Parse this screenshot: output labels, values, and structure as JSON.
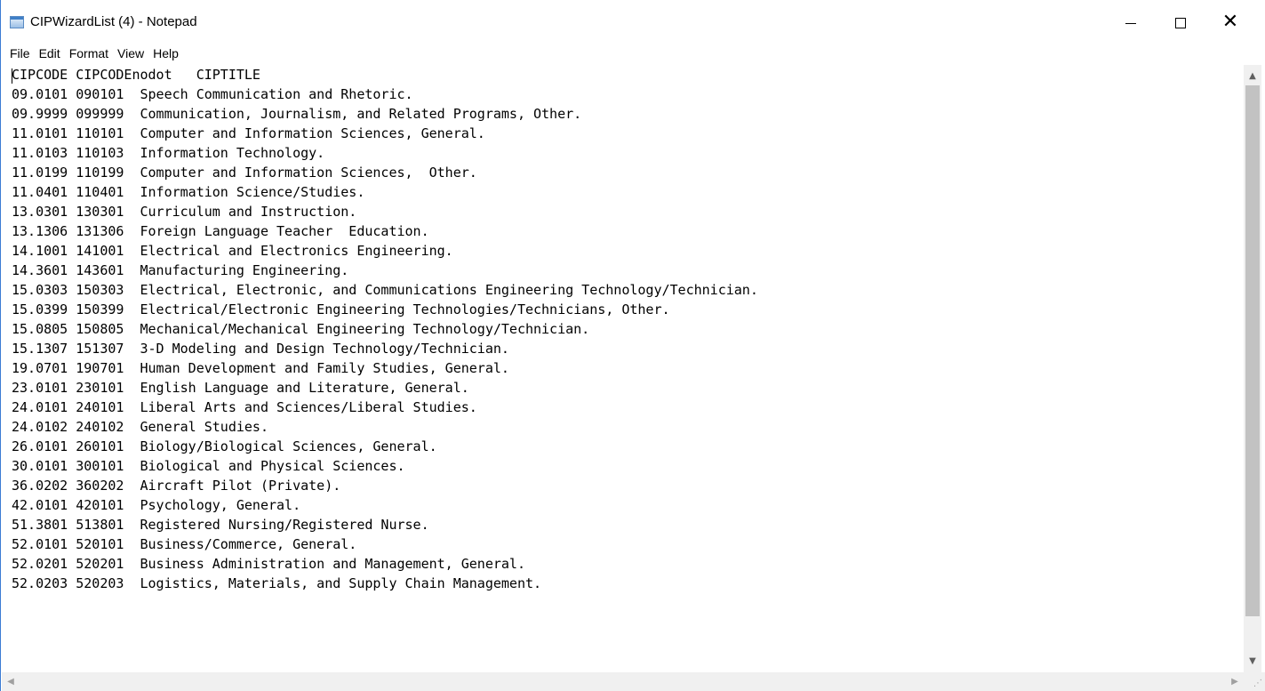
{
  "window": {
    "title": "CIPWizardList (4) - Notepad",
    "app_icon": "notepad-icon",
    "controls": {
      "minimize": "minimize-icon",
      "maximize": "maximize-icon",
      "close": "close-icon"
    }
  },
  "menu": [
    "File",
    "Edit",
    "Format",
    "View",
    "Help"
  ],
  "editor": {
    "lines": [
      "CIPCODE CIPCODEnodot   CIPTITLE",
      "09.0101 090101  Speech Communication and Rhetoric.",
      "09.9999 099999  Communication, Journalism, and Related Programs, Other.",
      "11.0101 110101  Computer and Information Sciences, General.",
      "11.0103 110103  Information Technology.",
      "11.0199 110199  Computer and Information Sciences,  Other.",
      "11.0401 110401  Information Science/Studies.",
      "13.0301 130301  Curriculum and Instruction.",
      "13.1306 131306  Foreign Language Teacher  Education.",
      "14.1001 141001  Electrical and Electronics Engineering.",
      "14.3601 143601  Manufacturing Engineering.",
      "15.0303 150303  Electrical, Electronic, and Communications Engineering Technology/Technician.",
      "15.0399 150399  Electrical/Electronic Engineering Technologies/Technicians, Other.",
      "15.0805 150805  Mechanical/Mechanical Engineering Technology/Technician.",
      "15.1307 151307  3-D Modeling and Design Technology/Technician.",
      "19.0701 190701  Human Development and Family Studies, General.",
      "23.0101 230101  English Language and Literature, General.",
      "24.0101 240101  Liberal Arts and Sciences/Liberal Studies.",
      "24.0102 240102  General Studies.",
      "26.0101 260101  Biology/Biological Sciences, General.",
      "30.0101 300101  Biological and Physical Sciences.",
      "36.0202 360202  Aircraft Pilot (Private).",
      "42.0101 420101  Psychology, General.",
      "51.3801 513801  Registered Nursing/Registered Nurse.",
      "52.0101 520101  Business/Commerce, General.",
      "52.0201 520201  Business Administration and Management, General.",
      "52.0203 520203  Logistics, Materials, and Supply Chain Management."
    ]
  },
  "scrollbars": {
    "vertical": {
      "up": "scroll-up-icon",
      "down": "scroll-down-icon"
    },
    "horizontal": {
      "left": "scroll-left-icon",
      "right": "scroll-right-icon"
    }
  }
}
